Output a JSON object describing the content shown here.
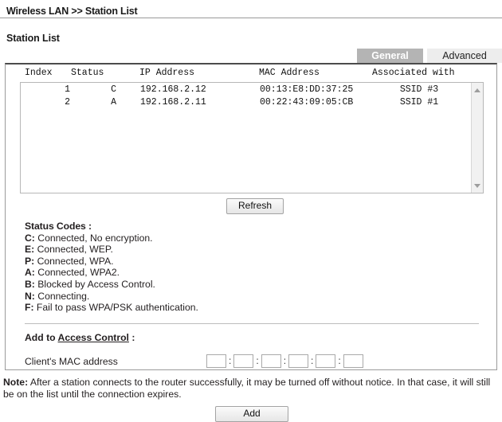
{
  "breadcrumb": "Wireless LAN >> Station List",
  "section": {
    "title": "Station List"
  },
  "tabs": [
    {
      "label": "General",
      "active": true
    },
    {
      "label": "Advanced",
      "active": false
    }
  ],
  "station_list": {
    "columns": [
      "Index",
      "Status",
      "IP Address",
      "MAC Address",
      "Associated with"
    ],
    "rows": [
      {
        "index": "1",
        "status": "C",
        "ip": "192.168.2.12",
        "mac": "00:13:E8:DD:37:25",
        "associated_with": "SSID #3"
      },
      {
        "index": "2",
        "status": "A",
        "ip": "192.168.2.11",
        "mac": "00:22:43:09:05:CB",
        "associated_with": "SSID #1"
      }
    ],
    "scrollbar": {
      "up_icon": "triangle-up-icon",
      "down_icon": "triangle-down-icon"
    }
  },
  "buttons": {
    "refresh": "Refresh",
    "add": "Add"
  },
  "status_codes": {
    "title": "Status Codes :",
    "items": [
      {
        "key": "C:",
        "text": " Connected, No encryption."
      },
      {
        "key": "E:",
        "text": " Connected, WEP."
      },
      {
        "key": "P:",
        "text": " Connected, WPA."
      },
      {
        "key": "A:",
        "text": " Connected, WPA2."
      },
      {
        "key": "B:",
        "text": " Blocked by Access Control."
      },
      {
        "key": "N:",
        "text": " Connecting."
      },
      {
        "key": "F:",
        "text": " Fail to pass WPA/PSK authentication."
      }
    ]
  },
  "access_control": {
    "prefix": "Add to",
    "link": "Access Control",
    "suffix": ":",
    "mac_label": "Client's MAC address",
    "mac_separator": ":",
    "mac_fields": [
      "",
      "",
      "",
      "",
      "",
      ""
    ],
    "mac_placeholder": ""
  },
  "note": {
    "label": "Note:",
    "text": " After a station connects to the router successfully, it may be turned off without notice. In that case, it will still be on the list until the connection expires."
  },
  "colors": {
    "tab_active_bg": "#b4b4b4",
    "tab_inactive_bg": "#ededed",
    "panel_border": "#9b9b9b",
    "panel_top_border": "#4c4c4c",
    "rule": "#9a9a9a",
    "text": "#231f20"
  }
}
